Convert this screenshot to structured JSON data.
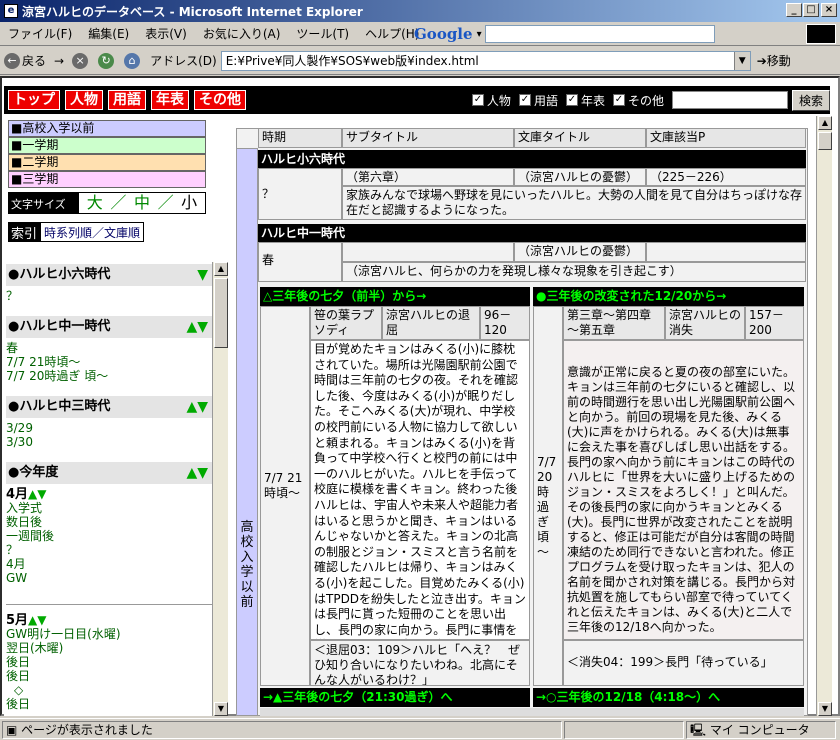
{
  "window": {
    "title": "涼宮ハルヒのデータベース - Microsoft Internet Explorer",
    "min": "_",
    "max": "□",
    "close": "×"
  },
  "menu": [
    "ファイル(F)",
    "編集(E)",
    "表示(V)",
    "お気に入り(A)",
    "ツール(T)",
    "ヘルプ(H)"
  ],
  "google": {
    "label": "Google",
    "arrow": "▾"
  },
  "toolbar": {
    "back": "戻る",
    "forward": "→",
    "address_label": "アドレス(D)",
    "address": "E:¥Prive¥同人製作¥SOS¥web版¥index.html",
    "go": "移動"
  },
  "nav": {
    "buttons": [
      "トップ",
      "人物",
      "用語",
      "年表",
      "その他"
    ],
    "checks": [
      "人物",
      "用語",
      "年表",
      "その他"
    ],
    "search_btn": "検索"
  },
  "terms": [
    {
      "label": "■高校入学以前",
      "color": "#ccccff"
    },
    {
      "label": "■一学期",
      "color": "#ccffcc"
    },
    {
      "label": "■二学期",
      "color": "#ffe0b0"
    },
    {
      "label": "■三学期",
      "color": "#ffd0ff"
    }
  ],
  "fontsize": {
    "label": "文字サイズ",
    "large": "大",
    "sep1": "／",
    "mid": "中",
    "sep2": "／",
    "small": "小"
  },
  "index": {
    "label": "索引",
    "chrono": "時系列順",
    "sep": "／",
    "bunko": "文庫順"
  },
  "left_eras": [
    {
      "title": "●ハルヒ小六時代",
      "tri": "▼",
      "links": [
        "？"
      ]
    },
    {
      "title": "●ハルヒ中一時代",
      "tri": "▲▼",
      "links": [
        "春",
        "7/7 21時頃～",
        "7/7 20時過ぎ 頃～"
      ]
    },
    {
      "title": "●ハルヒ中三時代",
      "tri": "▲▼",
      "links": [
        "3/29",
        "3/30"
      ]
    },
    {
      "title": "●今年度",
      "tri": "▲▼",
      "links": []
    }
  ],
  "april": {
    "title": "4月",
    "tri": "▲▼",
    "links": [
      "入学式",
      "数日後",
      "一週間後",
      "？",
      "4月",
      "GW"
    ]
  },
  "may": {
    "title": "5月",
    "tri": "▲▼",
    "links": [
      "GW明け一日目(水曜)",
      "翌日(木曜)",
      "後日",
      "後日",
      "◇",
      "後日"
    ]
  },
  "main": {
    "headers": [
      "時期",
      "サブタイトル",
      "文庫タイトル",
      "文庫該当P"
    ],
    "side_label": "高校入学以前",
    "sec1": {
      "title": "ハルヒ小六時代",
      "period": "？",
      "sub": "（第六章）",
      "bunko": "（涼宮ハルヒの憂鬱）",
      "pages": "（225－226）",
      "desc": "家族みんなで球場へ野球を見にいったハルヒ。大勢の人間を見て自分はちっぽけな存在だと認識するようになった。"
    },
    "sec2": {
      "title": "ハルヒ中一時代",
      "period": "春",
      "bunko": "（涼宮ハルヒの憂鬱）",
      "desc": "（涼宮ハルヒ、何らかの力を発現し様々な現象を引き起こす）"
    },
    "left_col": {
      "bar": "△三年後の七夕（前半）から→",
      "period": "7/7 21時頃～",
      "sub": "笹の葉ラプソディ",
      "bunko": "涼宮ハルヒの退屈",
      "pages": "96－120",
      "desc": "目が覚めたキョンはみくる(小)に膝枕されていた。場所は光陽園駅前公園で時間は三年前の七夕の夜。それを確認した後、今度はみくる(小)が眠りだした。そこへみくる(大)が現れ、中学校の校門前にいる人物に協力して欲しいと頼まれる。キョンはみくる(小)を背負って中学校へ行くと校門の前には中一のハルヒがいた。ハルヒを手伝って校庭に模様を書くキョン。終わった後ハルヒは、宇宙人や未来人や超能力者はいると思うかと聞き、キョンはいるんじゃないかと答えた。キョンの北高の制服とジョン・スミスと言う名前を確認したハルヒは帰り、キョンはみくる(小)を起こした。目覚めたみくる(小)はTPDDを紛失したと泣き出す。キョンは長門に貰った短冊のことを思い出し、長門の家に向かう。長門に事情を説明すると元の時間に戻れるようにしてくれると言い、和室に布団を敷きここに寝るようにと指示した。",
      "quote": "＜退屈03：109＞ハルヒ「へえ？　ぜひ知り合いになりたいわね。北高にそんな人がいるわけ？」",
      "footer": "→▲三年後の七夕（21:30過ぎ）へ"
    },
    "right_col": {
      "bar": "●三年後の改変された12/20から→",
      "period": "7/7 20時過ぎ頃～",
      "sub": "第三章～第四章～第五章",
      "bunko": "涼宮ハルヒの消失",
      "pages": "157－200",
      "desc": "意識が正常に戻ると夏の夜の部室にいた。キョンは三年前の七夕にいると確認し、以前の時間遡行を思い出し光陽園駅前公園へと向かう。前回の現場を見た後、みくる(大)に声をかけられる。みくる(大)は無事に会えた事を喜びしばし思い出話をする。長門の家へ向かう前にキョンはこの時代のハルヒに「世界を大いに盛り上げるためのジョン・スミスをよろしく！」と叫んだ。その後長門の家に向かうキョンとみくる(大)。長門に世界が改変されたことを説明すると、修正は可能だが自分は客間の時間凍結のため同行できないと言われた。修正プログラムを受け取ったキョンは、犯人の名前を聞かされ対策を講じる。長門から対抗処置を施してもらい部室で待っていてくれと伝えたキョンは、みくる(大)と二人で三年後の12/18へ向かった。",
      "quote": "＜消失04：199＞長門「待っている」",
      "footer": "→○三年後の12/18（4:18～）へ"
    }
  },
  "status": {
    "text": "ページが表示されました",
    "zone": "マイ コンピュータ"
  }
}
